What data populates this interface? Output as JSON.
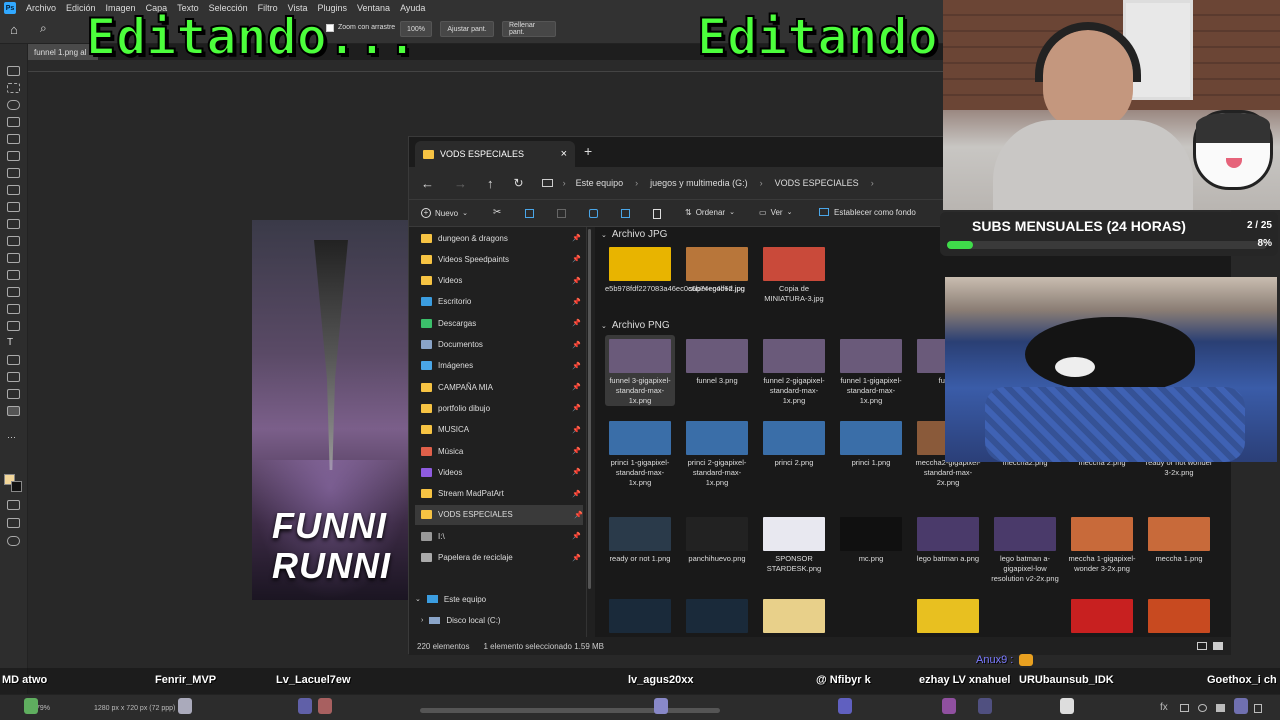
{
  "menubar": {
    "items": [
      "Archivo",
      "Edición",
      "Imagen",
      "Capa",
      "Texto",
      "Selección",
      "Filtro",
      "Vista",
      "Plugins",
      "Ventana",
      "Ayuda"
    ]
  },
  "options": {
    "zoom_drag_label": "Zoom con arrastre",
    "zoom_value": "100%",
    "fit_label": "Ajustar pant.",
    "fill_label": "Rellenar pant."
  },
  "document": {
    "tab_title": "funnel 1.png al",
    "art_line1": "FUNNI",
    "art_line2": "RUNNI"
  },
  "overlay": {
    "left_text": "Editando...",
    "right_text": "Editando"
  },
  "explorer": {
    "tab_title": "VODS ESPECIALES",
    "breadcrumb": [
      "Este equipo",
      "juegos y multimedia (G:)",
      "VODS ESPECIALES"
    ],
    "commands": {
      "new": "Nuevo",
      "sort": "Ordenar",
      "view": "Ver",
      "set_background": "Establecer como fondo"
    },
    "nav_items": [
      {
        "label": "dungeon & dragons",
        "color": "#f6c343"
      },
      {
        "label": "Videos Speedpaints",
        "color": "#f6c343"
      },
      {
        "label": "Videos",
        "color": "#f6c343"
      },
      {
        "label": "Escritorio",
        "color": "#3b9de0"
      },
      {
        "label": "Descargas",
        "color": "#3bbf6a"
      },
      {
        "label": "Documentos",
        "color": "#8aa4c8"
      },
      {
        "label": "Imágenes",
        "color": "#4aa6e8"
      },
      {
        "label": "CAMPAÑA MIA",
        "color": "#f6c343"
      },
      {
        "label": "portfolio dibujo",
        "color": "#f6c343"
      },
      {
        "label": "MUSICA",
        "color": "#f6c343"
      },
      {
        "label": "Música",
        "color": "#e0604a"
      },
      {
        "label": "Videos",
        "color": "#8f5ce0"
      },
      {
        "label": "Stream MadPatArt",
        "color": "#f6c343"
      },
      {
        "label": "VODS ESPECIALES",
        "color": "#f6c343"
      },
      {
        "label": "I:\\",
        "color": "#999999"
      },
      {
        "label": "Papelera de reciclaje",
        "color": "#aaaaaa"
      }
    ],
    "tree": {
      "this_pc": "Este equipo",
      "local_disk": "Disco local (C:)"
    },
    "groups": {
      "jpg": "Archivo JPG",
      "png": "Archivo PNG"
    },
    "jpg_files": [
      {
        "name": "e5b978fdf227083a46ec0c6b74ec4c6d.jpg",
        "color": "#e8b400"
      },
      {
        "name": "super+golf+2.jpg",
        "color": "#b8763a"
      },
      {
        "name": "Copia de MINIATURA-3.jpg",
        "color": "#c94a3a"
      }
    ],
    "png_row1": [
      {
        "name": "funnel 3-gigapixel-standard-max-1x.png",
        "color": "#6a5a7a"
      },
      {
        "name": "funnel 3.png",
        "color": "#6a5a7a"
      },
      {
        "name": "funnel 2-gigapixel-standard-max-1x.png",
        "color": "#6a5a7a"
      },
      {
        "name": "funnel 1-gigapixel-standard-max-1x.png",
        "color": "#6a5a7a"
      },
      {
        "name": "funne",
        "color": "#6a5a7a"
      }
    ],
    "png_row2": [
      {
        "name": "princi 1-gigapixel-standard-max-1x.png",
        "color": "#3a6ea8"
      },
      {
        "name": "princi 2-gigapixel-standard-max-1x.png",
        "color": "#3a6ea8"
      },
      {
        "name": "princi 2.png",
        "color": "#3a6ea8"
      },
      {
        "name": "princi 1.png",
        "color": "#3a6ea8"
      },
      {
        "name": "meccha2-gigapixel-standard-max-2x.png",
        "color": "#8a5a3a"
      },
      {
        "name": "meccha2.png",
        "color": "#8a5a3a"
      },
      {
        "name": "meccha 2.png",
        "color": "#8a5a3a"
      },
      {
        "name": "ready or not wonder 3-2x.png",
        "color": "#2a3a4a"
      }
    ],
    "png_row3": [
      {
        "name": "ready or not 1.png",
        "color": "#2a3a4a"
      },
      {
        "name": "panchihuevo.png",
        "color": "#222222"
      },
      {
        "name": "SPONSOR STARDESK.png",
        "color": "#e8e8f0"
      },
      {
        "name": "mc.png",
        "color": "#101010"
      },
      {
        "name": "lego batman a.png",
        "color": "#4a3a6a"
      },
      {
        "name": "lego batman a-gigapixel-low resolution v2-2x.png",
        "color": "#4a3a6a"
      },
      {
        "name": "meccha 1-gigapixel-wonder 3-2x.png",
        "color": "#c86a3a"
      },
      {
        "name": "meccha 1.png",
        "color": "#c86a3a"
      }
    ],
    "png_row4": [
      {
        "color": "#1a2a3a"
      },
      {
        "color": "#1a2a3a"
      },
      {
        "color": "#e8d08a"
      },
      {
        "color": "#e8c020"
      },
      {
        "color": "#c82020"
      },
      {
        "color": "#c84a20"
      }
    ],
    "status": {
      "count": "220 elementos",
      "selected": "1 elemento seleccionado  1.59 MB"
    }
  },
  "subs": {
    "label": "SUBS MENSUALES (24 HORAS)",
    "count": "2 / 25",
    "percent_text": "8%",
    "progress": 0.08
  },
  "chat": {
    "last_user": "Anux9 :"
  },
  "nicknames": [
    "MD atwo",
    "Fenrir_MVP",
    "Lv_Lacuel7ew",
    "lv_agus20xx",
    "@ Nfibyr k",
    "ezhay LV xnahuel",
    "URUbaunsub_IDK",
    "Goethox_i ch"
  ],
  "bottombar": {
    "zoom": "79%",
    "doc_size": "1280 px x 720 px (72 ppp)"
  }
}
